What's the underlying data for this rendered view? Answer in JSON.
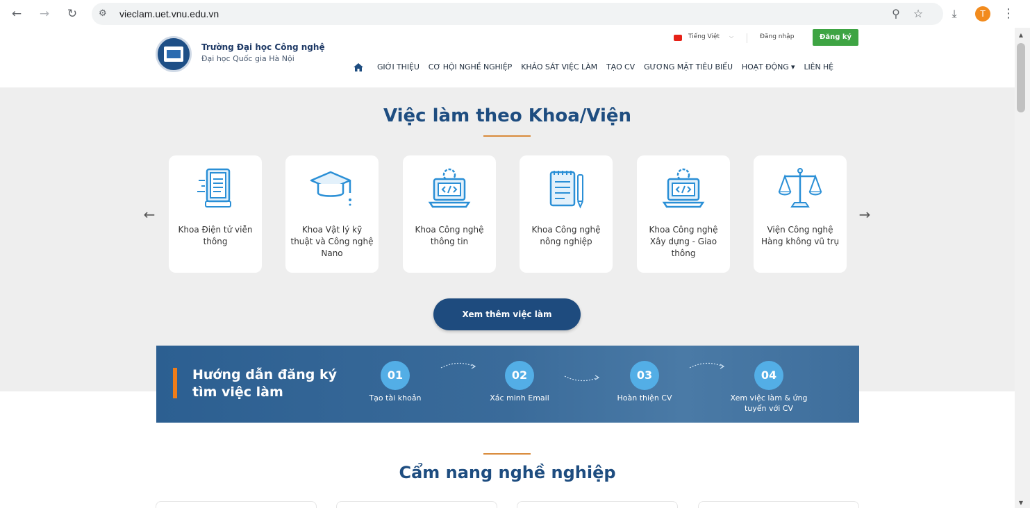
{
  "browser": {
    "url": "vieclam.uet.vnu.edu.vn",
    "profile_initial": "T"
  },
  "header": {
    "school_name": "Trường Đại học Công nghệ",
    "school_sub": "Đại học Quốc gia Hà Nội",
    "language": "Tiếng Việt",
    "login": "Đăng nhập",
    "register": "Đăng ký",
    "nav": [
      "GIỚI THIỆU",
      "CƠ HỘI NGHỀ NGHIỆP",
      "KHẢO SÁT VIỆC LÀM",
      "TẠO CV",
      "GƯƠNG MẶT TIÊU BIỂU",
      "HOẠT ĐỘNG ▾",
      "LIÊN HỆ"
    ]
  },
  "faculties": {
    "title": "Việc làm theo Khoa/Viện",
    "cards": [
      {
        "label": "Khoa Điện tử viễn thông",
        "icon": "document-icon"
      },
      {
        "label": "Khoa Vật lý  kỹ thuật và Công nghệ Nano",
        "icon": "graduation-cap-icon"
      },
      {
        "label": "Khoa Công nghệ thông tin",
        "icon": "laptop-code-icon"
      },
      {
        "label": "Khoa Công nghệ nông nghiệp",
        "icon": "notepad-icon"
      },
      {
        "label": "Khoa Công nghệ Xây dựng - Giao thông",
        "icon": "laptop-code-icon"
      },
      {
        "label": "Viện Công nghệ Hàng không vũ trụ",
        "icon": "scales-icon"
      }
    ],
    "more_button": "Xem thêm việc làm"
  },
  "guide": {
    "title_line1": "Hướng dẫn đăng ký",
    "title_line2": "tìm việc làm",
    "steps": [
      {
        "num": "01",
        "label": "Tạo tài khoản"
      },
      {
        "num": "02",
        "label": "Xác minh Email"
      },
      {
        "num": "03",
        "label": "Hoàn thiện CV"
      },
      {
        "num": "04",
        "label": "Xem việc làm & ứng tuyển với CV"
      }
    ]
  },
  "handbook": {
    "title": "Cẩm nang nghề nghiệp"
  },
  "colors": {
    "brand_blue": "#1e4d80",
    "accent_orange": "#d98a3a",
    "register_green": "#3ea443",
    "step_blue": "#53aee6"
  }
}
